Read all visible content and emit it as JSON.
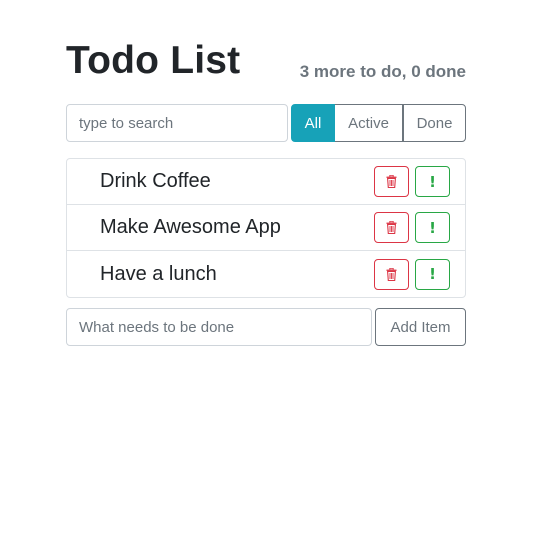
{
  "header": {
    "title": "Todo List",
    "status": "3 more to do, 0 done"
  },
  "search": {
    "placeholder": "type to search",
    "value": ""
  },
  "filters": {
    "all": "All",
    "active": "Active",
    "done": "Done",
    "selected": "All"
  },
  "items": [
    {
      "label": "Drink Coffee",
      "delete_icon": "trash-icon",
      "important_icon": "exclamation-icon",
      "important_glyph": "!"
    },
    {
      "label": "Make Awesome App",
      "delete_icon": "trash-icon",
      "important_icon": "exclamation-icon",
      "important_glyph": "!"
    },
    {
      "label": "Have a lunch",
      "delete_icon": "trash-icon",
      "important_icon": "exclamation-icon",
      "important_glyph": "!"
    }
  ],
  "add_form": {
    "placeholder": "What needs to be done",
    "value": "",
    "button_label": "Add Item"
  },
  "colors": {
    "accent": "#17a2b8",
    "danger": "#dc3545",
    "success": "#28a745",
    "secondary": "#6c757d"
  }
}
